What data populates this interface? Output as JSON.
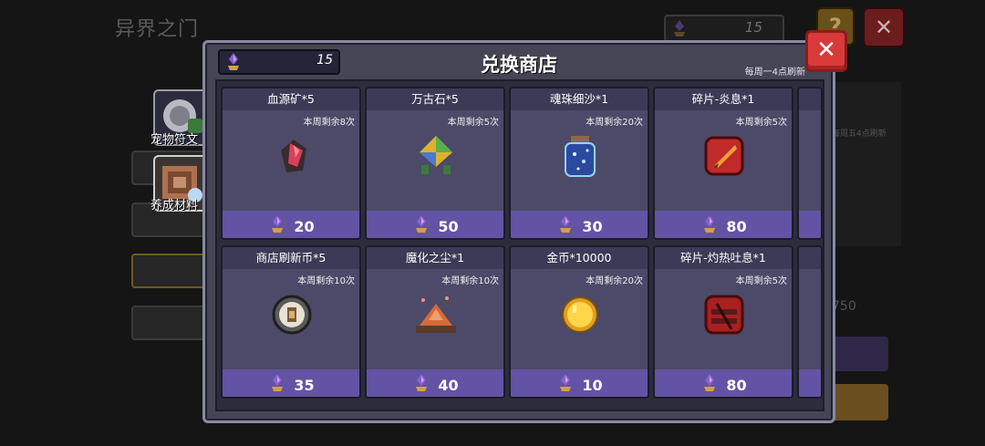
{
  "background": {
    "screen_title": "异界之门",
    "currency_amount": "15",
    "help_label": "?",
    "close_label": "✕",
    "side_tabs": [
      {
        "label": "宠物符文"
      },
      {
        "label": "养成材料"
      }
    ],
    "right_refresh_text": "每周五4点刷新",
    "right_amount": "750"
  },
  "shop": {
    "title": "兑换商店",
    "balance": "15",
    "refresh_note": "每周一4点刷新",
    "close_label": "✕",
    "items": [
      {
        "name": "血源矿*5",
        "limit": "本周剩余8次",
        "price": "20",
        "icon": "blood-ore-icon"
      },
      {
        "name": "万古石*5",
        "limit": "本周剩余5次",
        "price": "50",
        "icon": "ancient-stone-icon"
      },
      {
        "name": "魂珠细沙*1",
        "limit": "本周剩余20次",
        "price": "30",
        "icon": "soul-sand-jar-icon"
      },
      {
        "name": "碎片-炎息*1",
        "limit": "本周剩余5次",
        "price": "80",
        "icon": "fragment-flame-breath-icon"
      },
      {
        "name": "商店刷新币*5",
        "limit": "本周剩余10次",
        "price": "35",
        "icon": "refresh-coin-icon"
      },
      {
        "name": "魔化之尘*1",
        "limit": "本周剩余10次",
        "price": "40",
        "icon": "demonized-dust-icon"
      },
      {
        "name": "金币*10000",
        "limit": "本周剩余20次",
        "price": "10",
        "icon": "gold-coin-icon"
      },
      {
        "name": "碎片-灼热吐息*1",
        "limit": "本周剩余5次",
        "price": "80",
        "icon": "fragment-scorching-breath-icon"
      }
    ]
  },
  "colors": {
    "panel": "#454555",
    "card": "#4c4a68",
    "price_bar": "#6353a4",
    "close_button": "#d83a3a"
  }
}
